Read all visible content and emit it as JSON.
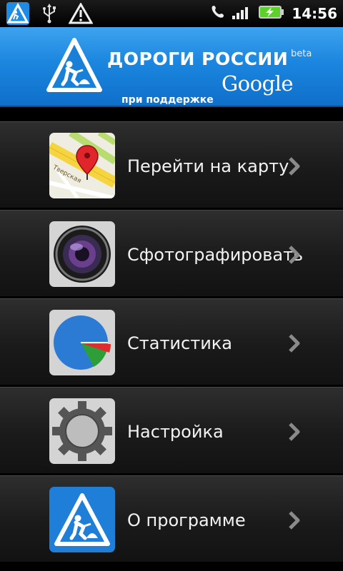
{
  "status_bar": {
    "time": "14:56",
    "icons": [
      "app-road-sign-icon",
      "usb-icon",
      "warning-icon",
      "phone-icon",
      "signal-icon",
      "battery-charging-icon"
    ]
  },
  "header": {
    "title": "ДОРОГИ РОССИИ",
    "beta": "beta",
    "subtitle": "при поддержке",
    "brand": "Google"
  },
  "menu": {
    "items": [
      {
        "label": "Перейти на карту",
        "icon": "map-pin-icon",
        "street": "Тверская"
      },
      {
        "label": "Сфотографировать",
        "icon": "camera-lens-icon"
      },
      {
        "label": "Статистика",
        "icon": "pie-chart-icon"
      },
      {
        "label": "Настройка",
        "icon": "gear-icon"
      },
      {
        "label": "О программе",
        "icon": "road-work-sign-icon"
      }
    ]
  },
  "colors": {
    "header_blue": "#1b86df",
    "menu_bg": "#1a1a1a",
    "battery_green": "#5bd12a"
  }
}
